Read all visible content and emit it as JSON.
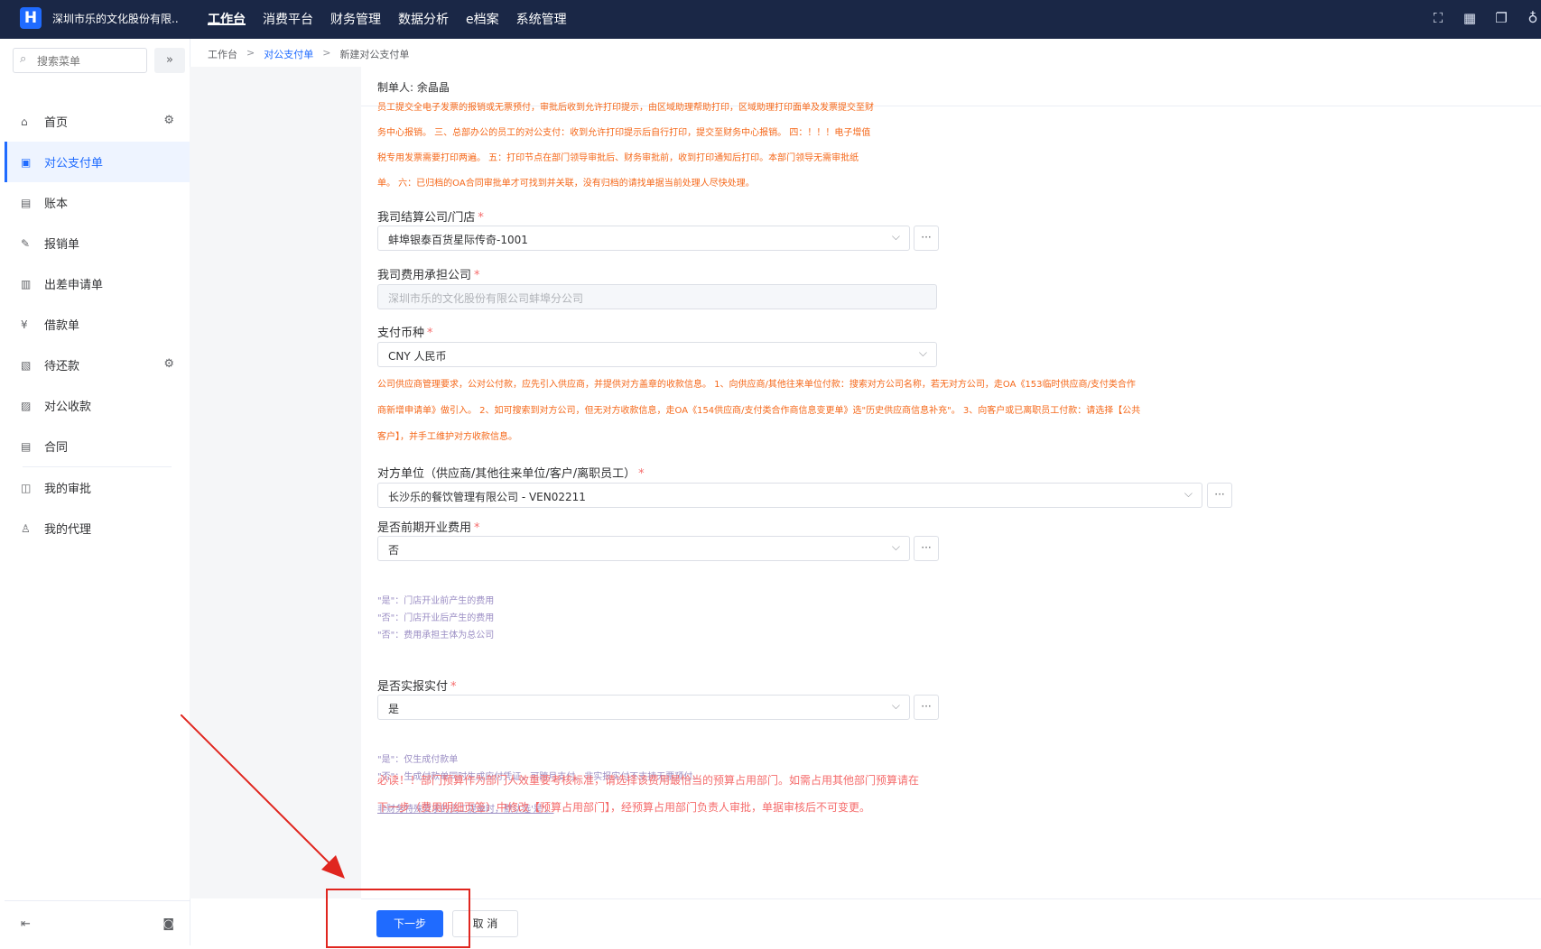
{
  "app": {
    "logo": "H",
    "company": "深圳市乐的文化股份有限..."
  },
  "topnav": [
    "工作台",
    "消费平台",
    "财务管理",
    "数据分析",
    "e档案",
    "系统管理"
  ],
  "sidebar": {
    "search_placeholder": "搜索菜单",
    "items": [
      {
        "label": "首页",
        "icon": "home-icon"
      },
      {
        "label": "对公支付单",
        "icon": "payment-doc-icon"
      },
      {
        "label": "账本",
        "icon": "ledger-icon"
      },
      {
        "label": "报销单",
        "icon": "reimburse-icon"
      },
      {
        "label": "出差申请单",
        "icon": "travel-icon"
      },
      {
        "label": "借款单",
        "icon": "loan-icon"
      },
      {
        "label": "待还款",
        "icon": "repay-icon"
      },
      {
        "label": "对公收款",
        "icon": "receipt-icon"
      },
      {
        "label": "合同",
        "icon": "contract-icon"
      },
      {
        "label": "我的审批",
        "icon": "approval-icon"
      },
      {
        "label": "我的代理",
        "icon": "proxy-icon"
      }
    ]
  },
  "breadcrumb": [
    "工作台",
    "对公支付单",
    "新建对公支付单"
  ],
  "form": {
    "maker_label": "制单人:",
    "maker_value": "余晶晶",
    "notice_lines": [
      "员工提交全电子发票的报销或无票预付，审批后收到允许打印提示，由区域助理帮助打印，区域助理打印面单及发票提交至财",
      "务中心报销。 三、总部办公的员工的对公支付：收到允许打印提示后自行打印，提交至财务中心报销。 四：！！！电子增值",
      "税专用发票需要打印两遍。 五：打印节点在部门领导审批后、财务审批前，收到打印通知后打印。本部门领导无需审批纸",
      "单。 六：已归档的OA合同审批单才可找到并关联，没有归档的请找单据当前处理人尽快处理。"
    ],
    "settle_company": {
      "label": "我司结算公司/门店",
      "value": "蚌埠银泰百货星际传奇-1001"
    },
    "cost_company": {
      "label": "我司费用承担公司",
      "value": "深圳市乐的文化股份有限公司蚌埠分公司"
    },
    "currency": {
      "label": "支付币种",
      "value": "CNY 人民币"
    },
    "supplier_notice_lines": [
      "公司供应商管理要求，公对公付款，应先引入供应商，并提供对方盖章的收款信息。 1、向供应商/其他往来单位付款：搜索对方公司名称，若无对方公司，走OA《153临时供应商/支付类合作",
      "商新增申请单》做引入。 2、如可搜索到对方公司，但无对方收款信息，走OA《154供应商/支付类合作商信息变更单》选\"历史供应商信息补充\"。 3、向客户或已离职员工付款：请选择【公共",
      "客户】，并手工维护对方收款信息。"
    ],
    "counterparty": {
      "label": "对方单位（供应商/其他往来单位/客户/离职员工）",
      "value": "长沙乐的餐饮管理有限公司 - VEN02211"
    },
    "pre_opening": {
      "label": "是否前期开业费用",
      "value": "否"
    },
    "pre_opening_hints": [
      "\"是\"：门店开业前产生的费用",
      "\"否\"：门店开业后产生的费用",
      "\"否\"：费用承担主体为总公司"
    ],
    "actual": {
      "label": "是否实报实付",
      "value": "是"
    },
    "actual_hints": [
      "\"是\"：仅生成付款单",
      "\"否\"：生成付款单同时生成应付凭证，可跨月支付。非实报实付不支持无票预付。"
    ],
    "actual_link": "非财务特殊要求的员工提单时，默认选'是'。",
    "budget_notice": "必读！！部门预算作为部门人效重要考核标准，请选择该费用最恰当的预算占用部门。如需占用其他部门预算请在下一步（费用明细页签）中修改【预算占用部门】，经预算占用部门负责人审批，单据审核后不可变更。"
  },
  "buttons": {
    "next": "下一步",
    "cancel": "取 消"
  },
  "colors": {
    "topbar": "#1a2746",
    "accent": "#1f6bff",
    "warning": "#f5681a",
    "danger": "#f56c6c",
    "annotation": "#e0261f"
  }
}
